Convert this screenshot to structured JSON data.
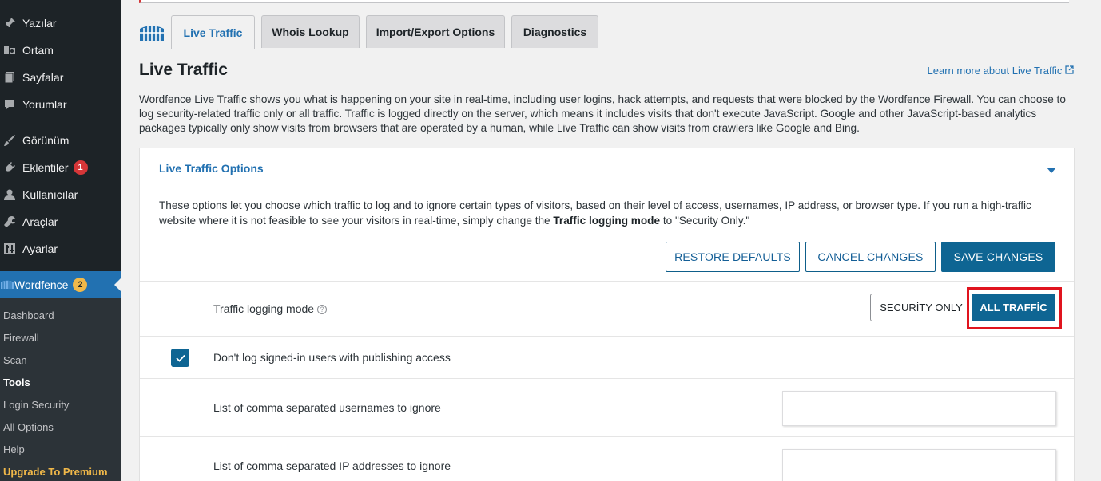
{
  "sidebar": {
    "items": [
      {
        "label": "Yazılar",
        "icon": "pin-icon"
      },
      {
        "label": "Ortam",
        "icon": "media-icon"
      },
      {
        "label": "Sayfalar",
        "icon": "pages-icon"
      },
      {
        "label": "Yorumlar",
        "icon": "comments-icon"
      },
      {
        "label": "Görünüm",
        "icon": "appearance-icon"
      },
      {
        "label": "Eklentiler",
        "icon": "plugins-icon",
        "badge": "1"
      },
      {
        "label": "Kullanıcılar",
        "icon": "users-icon"
      },
      {
        "label": "Araçlar",
        "icon": "tools-icon"
      },
      {
        "label": "Ayarlar",
        "icon": "settings-icon"
      }
    ],
    "active": {
      "label": "Wordfence",
      "icon": "wordfence-icon",
      "badge": "2"
    },
    "submenu": [
      "Dashboard",
      "Firewall",
      "Scan",
      "Tools",
      "Login Security",
      "All Options",
      "Help",
      "Upgrade To Premium"
    ],
    "current_sub": "Tools"
  },
  "tabs": [
    "Live Traffic",
    "Whois Lookup",
    "Import/Export Options",
    "Diagnostics"
  ],
  "active_tab": "Live Traffic",
  "page": {
    "title": "Live Traffic",
    "learn_more": "Learn more about Live Traffic",
    "description": "Wordfence Live Traffic shows you what is happening on your site in real-time, including user logins, hack attempts, and requests that were blocked by the Wordfence Firewall. You can choose to log security-related traffic only or all traffic. Traffic is logged directly on the server, which means it includes visits that don't execute JavaScript. Google and other JavaScript-based analytics packages typically only show visits from browsers that are operated by a human, while Live Traffic can show visits from crawlers like Google and Bing."
  },
  "panel": {
    "title": "Live Traffic Options",
    "desc_part1": "These options let you choose which traffic to log and to ignore certain types of visitors, based on their level of access, usernames, IP address, or browser type. If you run a high-traffic website where it is not feasible to see your visitors in real-time, simply change the ",
    "desc_bold": "Traffic logging mode",
    "desc_part2": " to \"Security Only.\"",
    "buttons": {
      "restore": "RESTORE DEFAULTS",
      "cancel": "CANCEL CHANGES",
      "save": "SAVE CHANGES"
    },
    "logging_mode_label": "Traffic logging mode",
    "mode_security": "SECURİTY ONLY",
    "mode_all": "ALL TRAFFİC",
    "checkbox_label": "Don't log signed-in users with publishing access",
    "usernames_label": "List of comma separated usernames to ignore",
    "ips_label": "List of comma separated IP addresses to ignore"
  },
  "colors": {
    "accent": "#2271b1",
    "primary_button": "#0e6593",
    "highlight": "#e0141e"
  }
}
